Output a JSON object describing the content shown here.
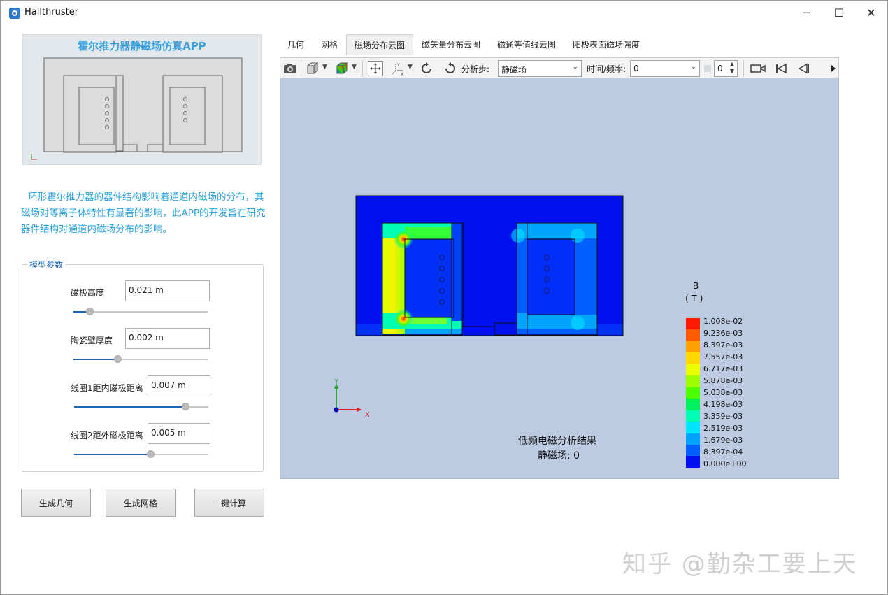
{
  "window": {
    "title": "Hallthruster",
    "minimize": "─",
    "maximize": "☐",
    "close": "✕"
  },
  "left": {
    "banner_title": "霍尔推力器静磁场仿真APP",
    "description": "环形霍尔推力器的器件结构影响着通道内磁场的分布，其磁场对等离子体特性有显著的影响，此APP的开发旨在研究器件结构对通道内磁场分布的影响。",
    "group_label": "模型参数",
    "params": [
      {
        "label": "磁极高度",
        "value": "0.021 m",
        "slider": 0.12
      },
      {
        "label": "陶瓷壁厚度",
        "value": "0.002 m",
        "slider": 0.33
      },
      {
        "label": "线圈1距内磁极距离",
        "value": "0.007 m",
        "slider": 0.83
      },
      {
        "label": "线圈2距外磁极距离",
        "value": "0.005 m",
        "slider": 0.57
      }
    ],
    "buttons": {
      "geometry": "生成几何",
      "mesh": "生成网格",
      "compute": "一键计算"
    }
  },
  "tabs": [
    "几何",
    "网格",
    "磁场分布云图",
    "磁矢量分布云图",
    "磁通等值线云图",
    "阳极表面磁场强度"
  ],
  "active_tab": "磁场分布云图",
  "toolbar": {
    "icons": [
      "camera-icon",
      "cube-view-icon",
      "color-map-icon",
      "fit-view-icon",
      "axes-icon",
      "rotate-left-icon",
      "rotate-right-icon",
      "video-icon",
      "first-frame-icon",
      "prev-frame-icon",
      "more-icon"
    ],
    "step_label": "分析步:",
    "step_value": "静磁场",
    "time_label": "时间/频率:",
    "time_value": "0",
    "frame_value": "0"
  },
  "viewer": {
    "result_title": "低频电磁分析结果",
    "result_sub": "静磁场: 0",
    "axis_x": "X",
    "axis_y": "Y",
    "legend_title_1": "B",
    "legend_title_2": "( T )",
    "legend_values": [
      "1.008e-02",
      "9.236e-03",
      "8.397e-03",
      "7.557e-03",
      "6.717e-03",
      "5.878e-03",
      "5.038e-03",
      "4.198e-03",
      "3.359e-03",
      "2.519e-03",
      "1.679e-03",
      "8.397e-04",
      "0.000e+00"
    ],
    "legend_colors": [
      "#ff1a00",
      "#ff5a00",
      "#ffa000",
      "#ffd800",
      "#eaff00",
      "#9cff00",
      "#4cff00",
      "#00f060",
      "#00ffb4",
      "#00e4ff",
      "#00a4ff",
      "#0060ff",
      "#0010f0"
    ]
  },
  "watermark": "知乎 @勤杂工要上天"
}
